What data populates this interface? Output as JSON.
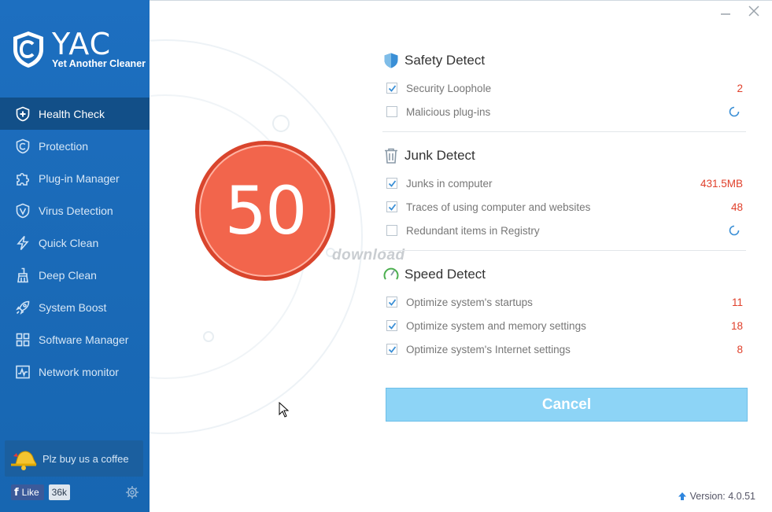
{
  "app": {
    "name": "YAC",
    "tagline": "Yet Another Cleaner"
  },
  "sidebar": {
    "items": [
      {
        "label": "Health Check",
        "icon": "health-check-icon",
        "active": true
      },
      {
        "label": "Protection",
        "icon": "protection-icon"
      },
      {
        "label": "Plug-in Manager",
        "icon": "puzzle-icon"
      },
      {
        "label": "Virus Detection",
        "icon": "virus-shield-icon"
      },
      {
        "label": "Quick Clean",
        "icon": "lightning-icon"
      },
      {
        "label": "Deep Clean",
        "icon": "broom-icon"
      },
      {
        "label": "System Boost",
        "icon": "rocket-icon"
      },
      {
        "label": "Software Manager",
        "icon": "grid-icon"
      },
      {
        "label": "Network monitor",
        "icon": "pulse-icon"
      }
    ],
    "coffee_label": "Plz buy us a coffee",
    "like_label": "Like",
    "like_count": "36k"
  },
  "score": {
    "value": "50"
  },
  "sections": {
    "safety": {
      "title": "Safety Detect",
      "rows": [
        {
          "label": "Security Loophole",
          "value": "2",
          "checked": true
        },
        {
          "label": "Malicious plug-ins",
          "value": "",
          "checked": false,
          "loading": true
        }
      ]
    },
    "junk": {
      "title": "Junk Detect",
      "rows": [
        {
          "label": "Junks in computer",
          "value": "431.5MB",
          "checked": true
        },
        {
          "label": "Traces of using computer and websites",
          "value": "48",
          "checked": true
        },
        {
          "label": "Redundant items in Registry",
          "value": "",
          "checked": false,
          "loading": true
        }
      ]
    },
    "speed": {
      "title": "Speed Detect",
      "rows": [
        {
          "label": "Optimize system's startups",
          "value": "11",
          "checked": true
        },
        {
          "label": "Optimize system and memory settings",
          "value": "18",
          "checked": true
        },
        {
          "label": "Optimize system's Internet settings",
          "value": "8",
          "checked": true
        }
      ]
    }
  },
  "cancel_label": "Cancel",
  "version_label": "Version: 4.0.51",
  "watermark": "download",
  "colors": {
    "sidebar": "#1b6bb9",
    "active": "#124f88",
    "score": "#f2654c",
    "value": "#e0402b",
    "button": "#8dd4f6"
  }
}
